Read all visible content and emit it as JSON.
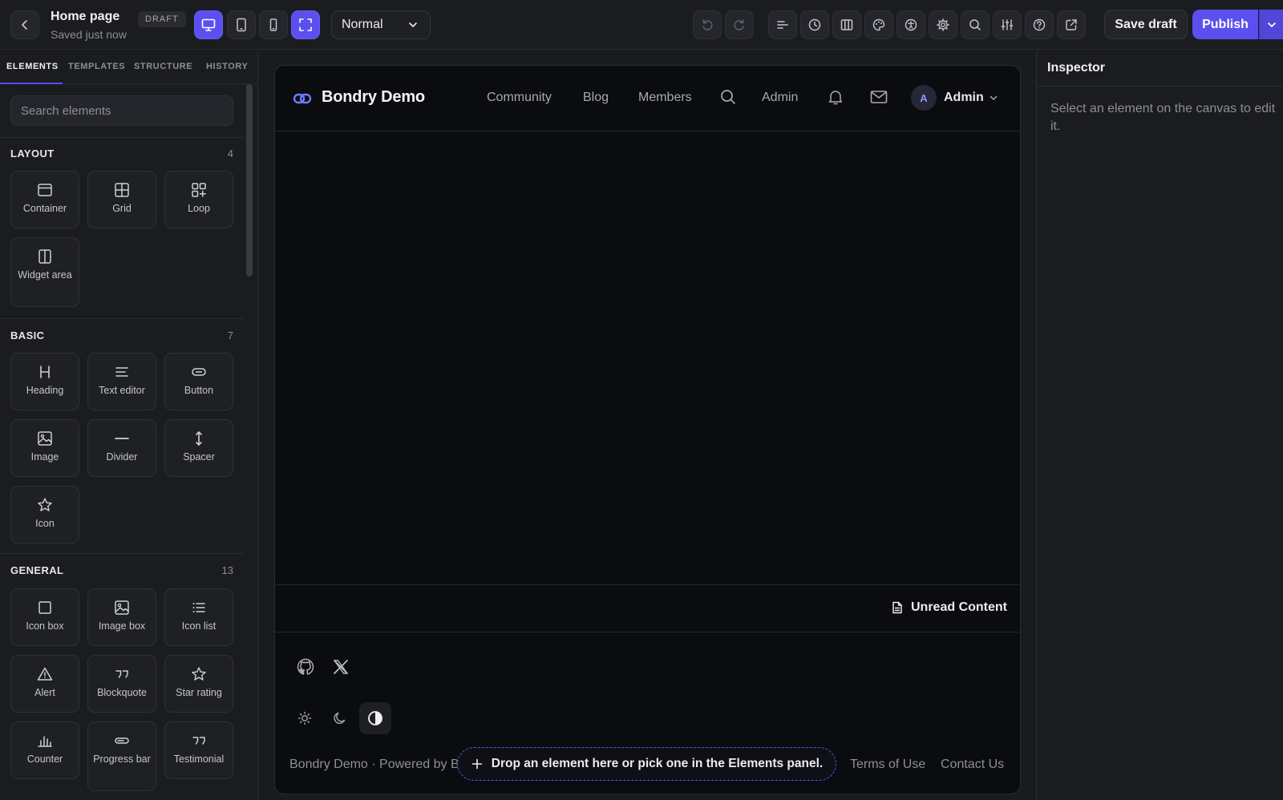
{
  "topbar": {
    "page_title": "Home page",
    "page_status": "DRAFT",
    "save_status": "Saved just now",
    "mode_select": "Normal",
    "save_draft_label": "Save draft",
    "publish_label": "Publish"
  },
  "left_panel": {
    "tabs": [
      "ELEMENTS",
      "TEMPLATES",
      "STRUCTURE",
      "HISTORY"
    ],
    "active_tab": "ELEMENTS",
    "search_placeholder": "Search elements",
    "sections": {
      "layout": {
        "title": "LAYOUT",
        "count": "4",
        "items": [
          "Container",
          "Grid",
          "Loop",
          "Widget area"
        ]
      },
      "basic": {
        "title": "BASIC",
        "count": "7",
        "items": [
          "Heading",
          "Text editor",
          "Button",
          "Image",
          "Divider",
          "Spacer",
          "Icon"
        ]
      },
      "general": {
        "title": "GENERAL",
        "count": "13",
        "items": [
          "Icon box",
          "Image box",
          "Icon list",
          "Alert",
          "Blockquote",
          "Star rating",
          "Counter",
          "Progress bar",
          "Testimonial"
        ]
      }
    }
  },
  "canvas": {
    "site_name": "Bondry Demo",
    "nav": {
      "community": "Community",
      "blog": "Blog",
      "members": "Members",
      "admin": "Admin"
    },
    "user": {
      "initial": "A",
      "name": "Admin"
    },
    "unread_label": "Unread Content",
    "footer_text": "Bondry Demo · Powered by B",
    "footer_links": {
      "terms": "Terms of Use",
      "contact": "Contact Us"
    },
    "drop_hint": "Drop an element here or pick one in the Elements panel."
  },
  "inspector": {
    "title": "Inspector",
    "empty_text": "Select an element on the canvas to edit it."
  },
  "colors": {
    "accent": "#5b4ff0",
    "background": "#1b1c20",
    "canvas": "#0b0c0f"
  }
}
